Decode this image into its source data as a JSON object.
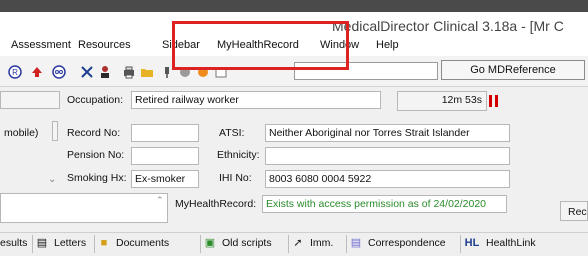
{
  "window": {
    "title": "MedicalDirector Clinical 3.18a - [Mr C"
  },
  "menu": {
    "items": [
      "Assessment",
      "Resources",
      "Sidebar",
      "MyHealthRecord",
      "Window",
      "Help"
    ]
  },
  "toolbar": {
    "go_ref_label": "Go MDReference",
    "icons": [
      "reference-icon",
      "alert-icon",
      "glasses-icon",
      "cut-icon",
      "person-icon",
      "print-icon",
      "folder-icon",
      "pin-icon",
      "grey-circle-icon",
      "orange-circle-icon",
      "window-icon"
    ]
  },
  "patient": {
    "occupation_label": "Occupation:",
    "occupation_value": "Retired railway worker",
    "timer": "12m 53s",
    "mobile_label": "mobile)",
    "record_no_label": "Record No:",
    "record_no_value": "",
    "atsi_label": "ATSI:",
    "atsi_value": "Neither Aboriginal nor Torres Strait Islander",
    "pension_no_label": "Pension No:",
    "pension_no_value": "",
    "ethnicity_label": "Ethnicity:",
    "ethnicity_value": "",
    "smoking_label": "Smoking Hx:",
    "smoking_value": "Ex-smoker",
    "ihi_label": "IHI No:",
    "ihi_value": "8003 6080 0004 5922",
    "mhr_label": "MyHealthRecord:",
    "mhr_value": "Exists with access permission as of 24/02/2020",
    "recalls_label": "Recalls"
  },
  "tabs": [
    "esults",
    "Letters",
    "Documents",
    "Old scripts",
    "Imm.",
    "Correspondence",
    "HealthLink"
  ],
  "colors": {
    "highlight": "#d22222",
    "mhr_text": "#2a8c2a",
    "pause": "#d40000"
  }
}
